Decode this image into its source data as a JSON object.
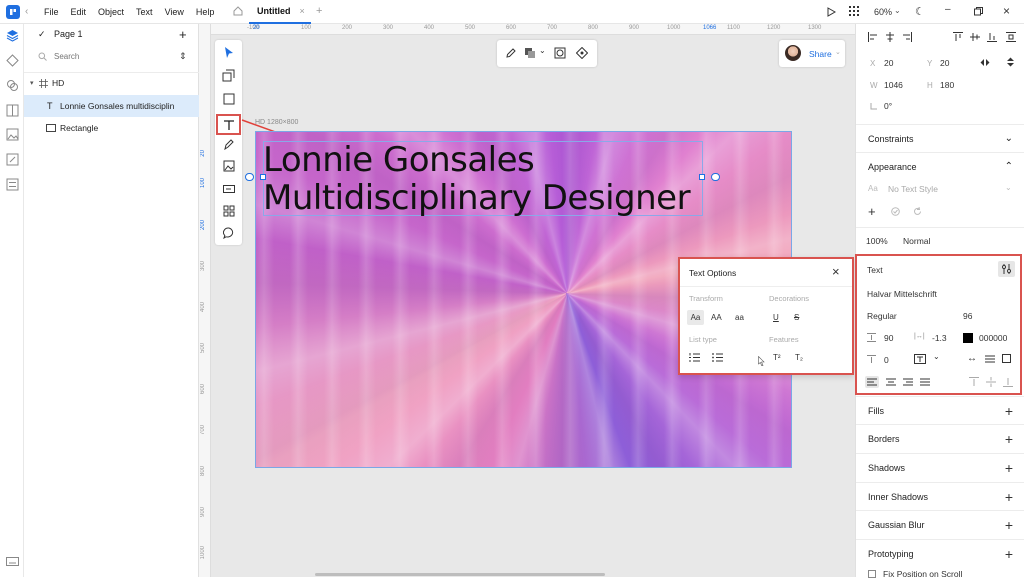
{
  "titlebar": {
    "menus": [
      "File",
      "Edit",
      "Object",
      "Text",
      "View",
      "Help"
    ],
    "tab_title": "Untitled",
    "zoom": "60%"
  },
  "layers": {
    "page_name": "Page 1",
    "search_placeholder": "Search",
    "items": [
      {
        "label": "HD",
        "type": "group"
      },
      {
        "label": "Lonnie Gonsales multidisciplin",
        "type": "text",
        "selected": true
      },
      {
        "label": "Rectangle",
        "type": "rect"
      }
    ]
  },
  "rulers": {
    "top": [
      "-100",
      "20",
      "100",
      "200",
      "300",
      "400",
      "500",
      "600",
      "700",
      "800",
      "900",
      "1000",
      "1066",
      "1100",
      "1200",
      "1300"
    ],
    "left": [
      "20",
      "100",
      "200",
      "300",
      "400",
      "500",
      "600",
      "700",
      "800",
      "900",
      "1000"
    ]
  },
  "canvas": {
    "artboard_label": "HD 1280×800",
    "headline_line1": "Lonnie Gonsales",
    "headline_line2": "Multidisciplinary Designer",
    "share_label": "Share"
  },
  "text_options": {
    "title": "Text Options",
    "transform_label": "Transform",
    "decorations_label": "Decorations",
    "list_type_label": "List type",
    "features_label": "Features",
    "transform_options": [
      "Aa",
      "AA",
      "aa"
    ],
    "decoration_options": [
      "U",
      "S"
    ],
    "feature_options": [
      "T²",
      "T₂"
    ]
  },
  "props": {
    "x_label": "X",
    "x": "20",
    "y_label": "Y",
    "y": "20",
    "w_label": "W",
    "w": "1046",
    "h_label": "H",
    "h": "180",
    "rotation": "0°",
    "constraints": "Constraints",
    "appearance": "Appearance",
    "text_style": "No Text Style",
    "opacity": "100%",
    "blend": "Normal",
    "text_section": "Text",
    "font_family": "Halvar Mittelschrift",
    "font_weight": "Regular",
    "font_size": "96",
    "line_height": "90",
    "letter_spacing": "-1.3",
    "color_hex": "000000",
    "paragraph_spacing": "0",
    "fills": "Fills",
    "borders": "Borders",
    "shadows": "Shadows",
    "inner_shadows": "Inner Shadows",
    "gaussian_blur": "Gaussian Blur",
    "prototyping": "Prototyping",
    "fix_position": "Fix Position on Scroll"
  }
}
